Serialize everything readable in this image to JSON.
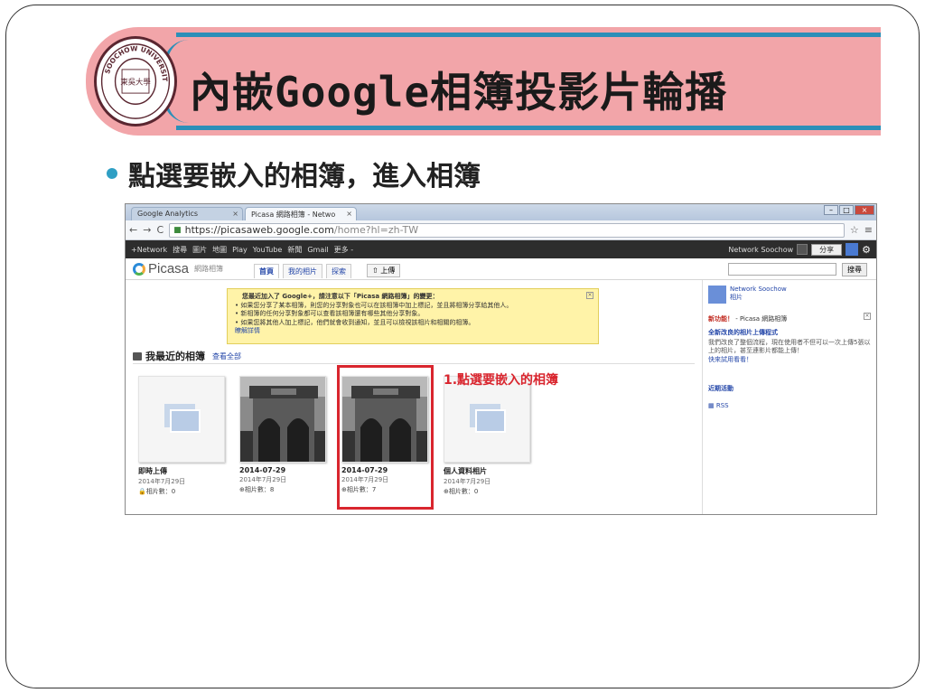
{
  "slide": {
    "title": "內嵌Google相簿投影片輪播",
    "bullet": "點選要嵌入的相簿，進入相簿"
  },
  "logo": {
    "text": "SOOCHOW UNIVERSITY",
    "cn": "東吳大學"
  },
  "browser": {
    "tabs": [
      {
        "label": "Google Analytics",
        "close": "×"
      },
      {
        "label": "Picasa 網路相簿 - Netwo",
        "close": "×"
      }
    ],
    "nav": {
      "back": "←",
      "forward": "→",
      "reload": "C"
    },
    "url_host": "https://picasaweb.google.com",
    "url_path": "/home?hl=zh-TW",
    "star": "☆",
    "menu": "≡"
  },
  "gbar": {
    "items": [
      "+Network",
      "搜尋",
      "圖片",
      "地圖",
      "Play",
      "YouTube",
      "新聞",
      "Gmail",
      "更多 -"
    ],
    "user": "Network Soochow",
    "share": "分享"
  },
  "picasa": {
    "logo": "Picasa",
    "logo_sub": "網路相簿",
    "tabs": [
      "首頁",
      "我的相片",
      "探索"
    ],
    "upload": "上傳",
    "search_btn": "搜尋"
  },
  "notice": {
    "heading": "您最近加入了 Google+，請注意以下「Picasa 網路相簿」的變更：",
    "items": [
      "如果您分享了某本相簿，則您的分享對象也可以在該相簿中加上標記，並且將相簿分享給其他人。",
      "新相簿的任何分享對象都可以查看該相簿還有哪些其他分享對象。",
      "如果您將其他人加上標記，他們就會收到通知，並且可以檢視該相片和相關的相簿。"
    ],
    "learn_more": "瞭解詳情",
    "close": "×"
  },
  "recent": {
    "heading": "我最近的相簿",
    "view_all": "查看全部"
  },
  "albums": [
    {
      "title": "即時上傳",
      "date": "2014年7月29日",
      "count": "相片數：0"
    },
    {
      "title": "2014-07-29",
      "date": "2014年7月29日",
      "count": "相片數：8"
    },
    {
      "title": "2014-07-29",
      "date": "2014年7月29日",
      "count": "相片數：7"
    },
    {
      "title": "個人資料相片",
      "date": "2014年7月29日",
      "count": "相片數：0"
    }
  ],
  "callout": "1.點選要嵌入的相簿",
  "sidebar": {
    "user": "Network Soochow",
    "user_sub": "相片",
    "new_label": "新功能！",
    "new_rest": " - Picasa 網路相簿",
    "link": "全新改良的相片上傳程式",
    "body": "我們改良了整個流程，現在使用者不但可以一次上傳5張以上的相片，甚至連影片都能上傳！",
    "try": "快來試用看看！",
    "close": "×",
    "activity": "近期活動",
    "rss": "RSS"
  },
  "colors": {
    "banner": "#f2a5a9",
    "accent": "#2c8fb8",
    "highlight": "#d9252e",
    "bullet": "#2f9fc4"
  }
}
